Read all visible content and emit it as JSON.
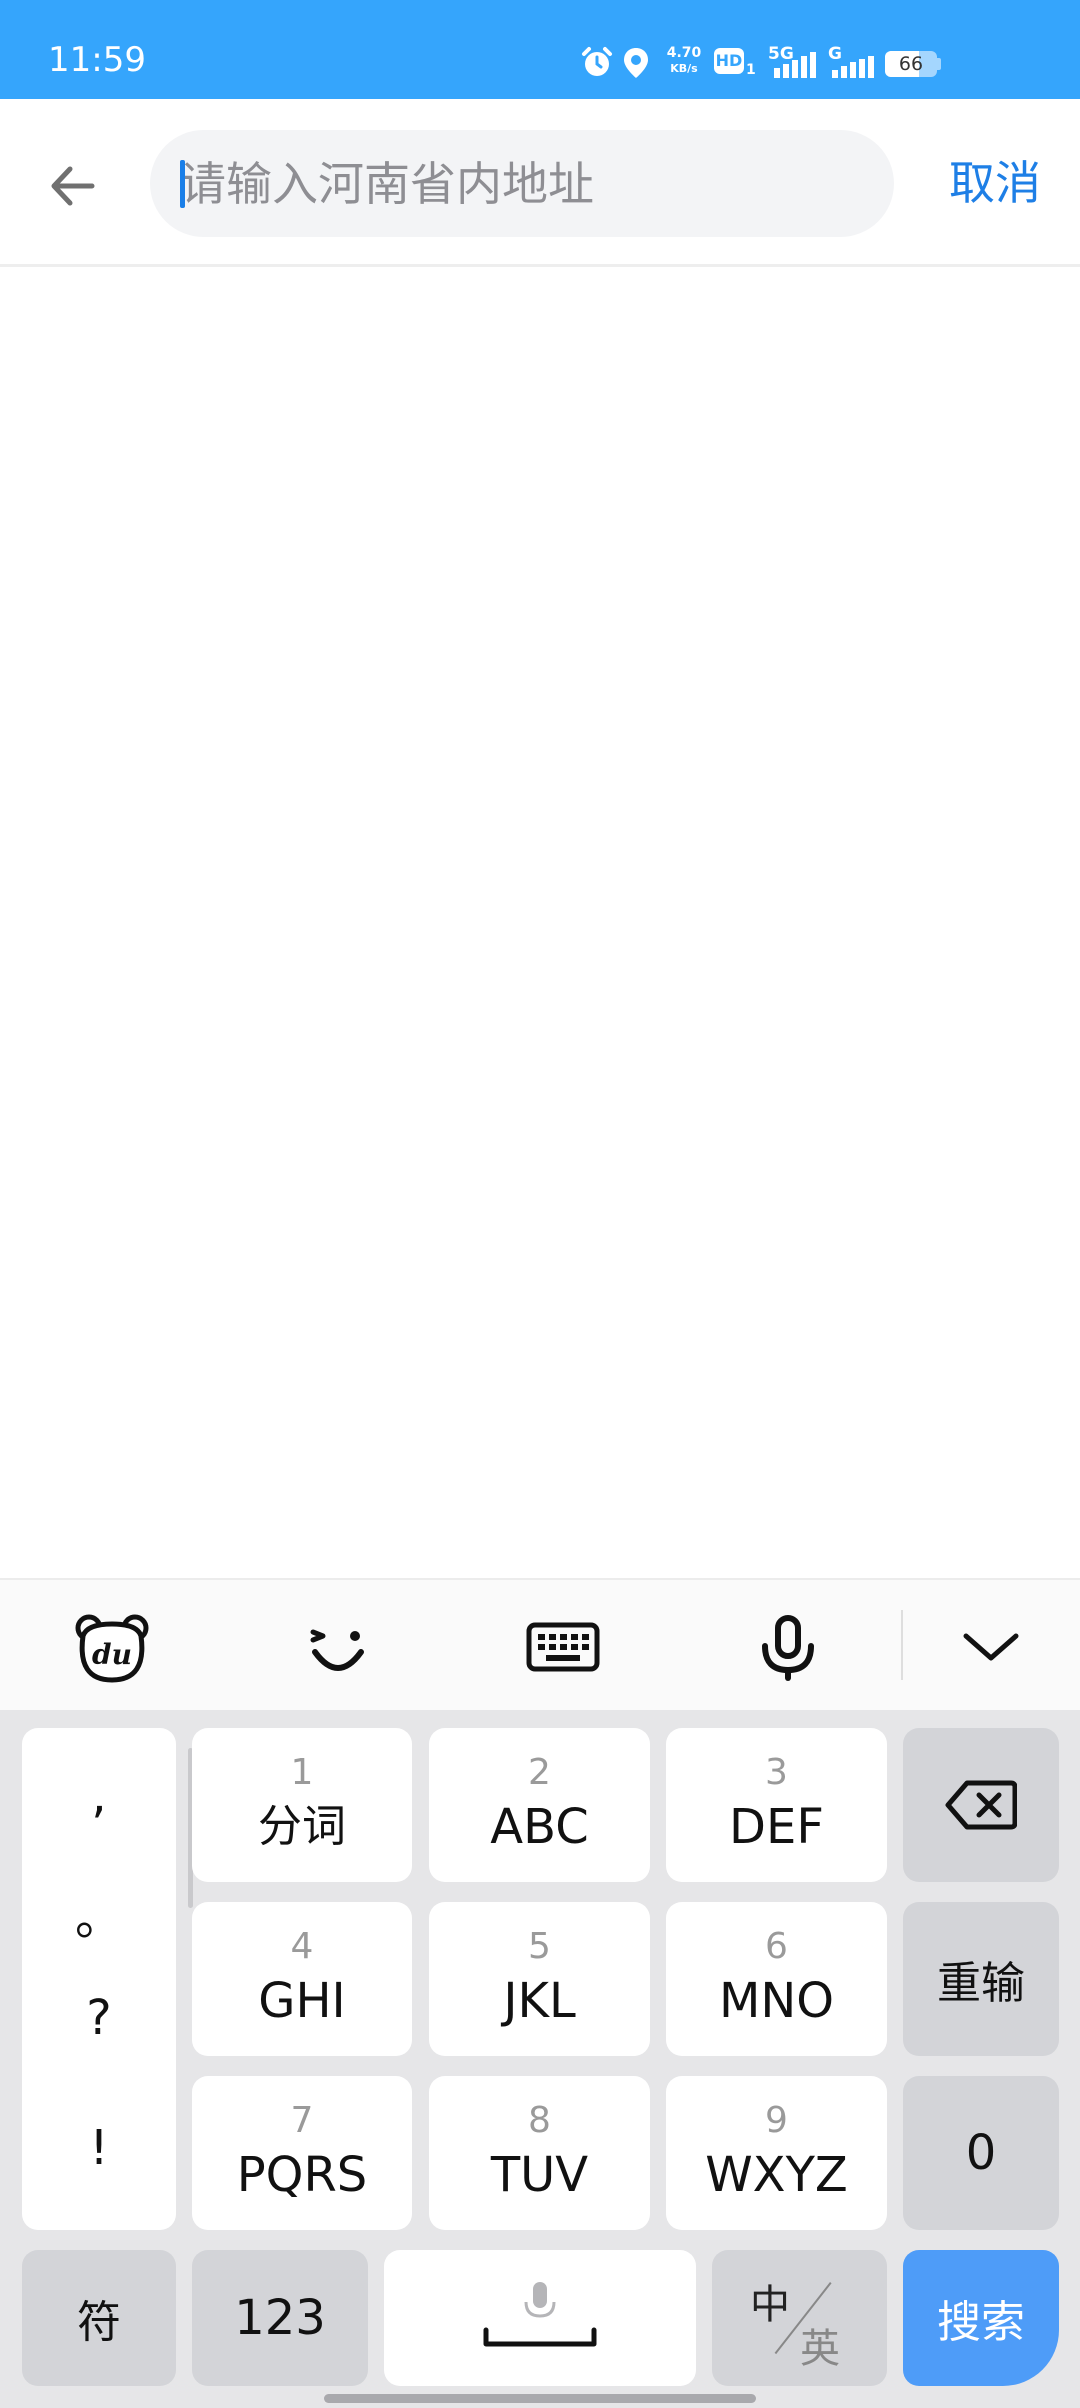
{
  "status_bar": {
    "time": "11:59",
    "net_speed_value": "4.70",
    "net_speed_unit": "KB/s",
    "hd_label": "HD",
    "hd_sub": "1",
    "sim1_label": "5G",
    "sim2_label": "G",
    "battery_level": "66",
    "battery_fraction": 0.66
  },
  "header": {
    "search_placeholder": "请输入河南省内地址",
    "search_value": "",
    "cancel_label": "取消"
  },
  "keyboard_toolbar": {
    "icons": [
      "du-bear-icon",
      "emoji-icon",
      "keyboard-icon",
      "microphone-icon",
      "collapse-icon"
    ]
  },
  "keyboard": {
    "punctuation": [
      ",",
      "。",
      "?",
      "!"
    ],
    "keys": {
      "k1": {
        "num": "1",
        "letters": "分词"
      },
      "k2": {
        "num": "2",
        "letters": "ABC"
      },
      "k3": {
        "num": "3",
        "letters": "DEF"
      },
      "k4": {
        "num": "4",
        "letters": "GHI"
      },
      "k5": {
        "num": "5",
        "letters": "JKL"
      },
      "k6": {
        "num": "6",
        "letters": "MNO"
      },
      "k7": {
        "num": "7",
        "letters": "PQRS"
      },
      "k8": {
        "num": "8",
        "letters": "TUV"
      },
      "k9": {
        "num": "9",
        "letters": "WXYZ"
      }
    },
    "delete_icon": "backspace-icon",
    "reenter_label": "重输",
    "zero_label": "0",
    "symbols_label": "符",
    "num123_label": "123",
    "space_icon": "space-mic-icon",
    "zh_label": "中",
    "en_label": "英",
    "search_label": "搜索"
  },
  "colors": {
    "status_bar": "#35a5fc",
    "accent": "#1e7fe6",
    "search_key": "#4e9cf8",
    "keyboard_bg": "#e6e6e8"
  }
}
